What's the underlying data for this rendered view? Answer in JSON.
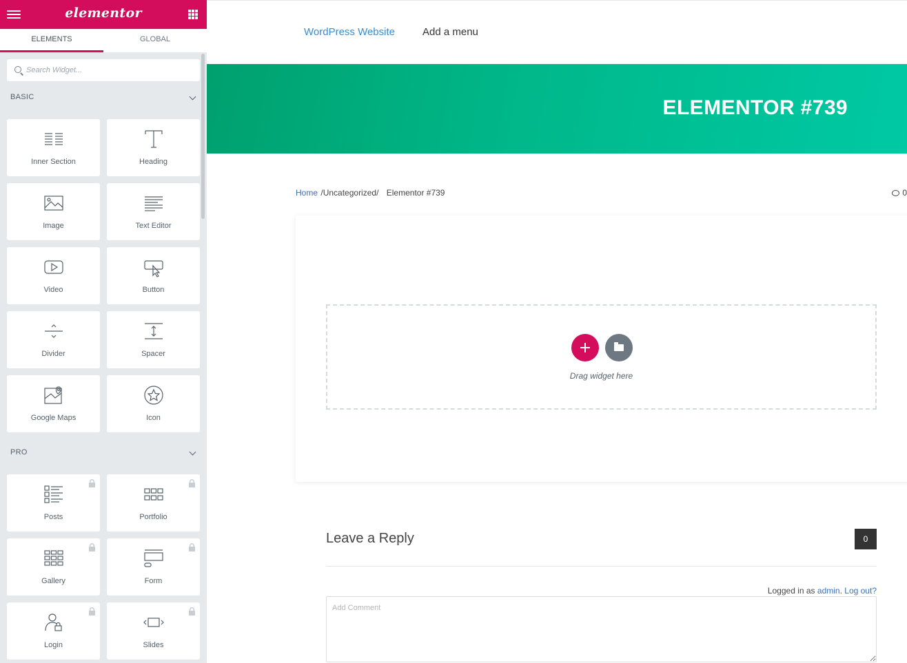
{
  "sidebar": {
    "logo": "elementor",
    "tabs": [
      {
        "label": "ELEMENTS"
      },
      {
        "label": "GLOBAL"
      }
    ],
    "search": {
      "placeholder": "Search Widget..."
    },
    "categories": [
      {
        "label": "BASIC"
      },
      {
        "label": "PRO"
      }
    ],
    "basic_widgets": [
      {
        "label": "Inner Section",
        "icon": "inner-section-icon"
      },
      {
        "label": "Heading",
        "icon": "heading-icon"
      },
      {
        "label": "Image",
        "icon": "image-icon"
      },
      {
        "label": "Text Editor",
        "icon": "text-editor-icon"
      },
      {
        "label": "Video",
        "icon": "video-icon"
      },
      {
        "label": "Button",
        "icon": "button-icon"
      },
      {
        "label": "Divider",
        "icon": "divider-icon"
      },
      {
        "label": "Spacer",
        "icon": "spacer-icon"
      },
      {
        "label": "Google Maps",
        "icon": "google-maps-icon"
      },
      {
        "label": "Icon",
        "icon": "star-icon"
      }
    ],
    "pro_widgets": [
      {
        "label": "Posts",
        "icon": "posts-icon"
      },
      {
        "label": "Portfolio",
        "icon": "portfolio-icon"
      },
      {
        "label": "Gallery",
        "icon": "gallery-icon"
      },
      {
        "label": "Form",
        "icon": "form-icon"
      },
      {
        "label": "Login",
        "icon": "login-icon"
      },
      {
        "label": "Slides",
        "icon": "slides-icon"
      }
    ]
  },
  "preview": {
    "nav": {
      "site": "WordPress Website",
      "menu": "Add a menu"
    },
    "hero_title": "ELEMENTOR #739",
    "breadcrumb": {
      "home": "Home",
      "category": "/Uncategorized/",
      "current": "Elementor #739"
    },
    "comment_count": "0",
    "dropzone": {
      "hint": "Drag widget here"
    },
    "reply": {
      "title": "Leave a Reply",
      "count": "0",
      "logged_prefix": "Logged in as",
      "user": "admin",
      "logout": "Log out?",
      "placeholder": "Add Comment"
    }
  },
  "colors": {
    "accent": "#d30c5c",
    "hero_start": "#00a06e",
    "hero_end": "#00c9a4",
    "link": "#3a8bd0"
  }
}
